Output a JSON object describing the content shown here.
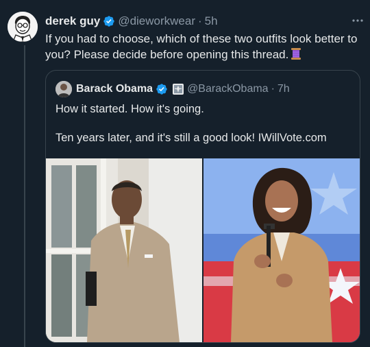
{
  "tweet": {
    "author_name": "derek guy",
    "handle": "@dieworkwear",
    "separator": "·",
    "time": "5h",
    "text": "If you had to choose, which of these two outfits look better to you? Please decide before opening this thread.",
    "emoji_icon": "thread-spool-icon"
  },
  "quote": {
    "author_name": "Barack Obama",
    "handle": "@BarackObama",
    "separator": "·",
    "time": "7h",
    "line1": "How it started. How it's going.",
    "line2": "Ten years later, and it's still a good look! IWillVote.com"
  },
  "colors": {
    "background": "#15202b",
    "border": "#38444d",
    "muted_text": "#8b98a5",
    "verified_blue": "#1d9bf0"
  }
}
